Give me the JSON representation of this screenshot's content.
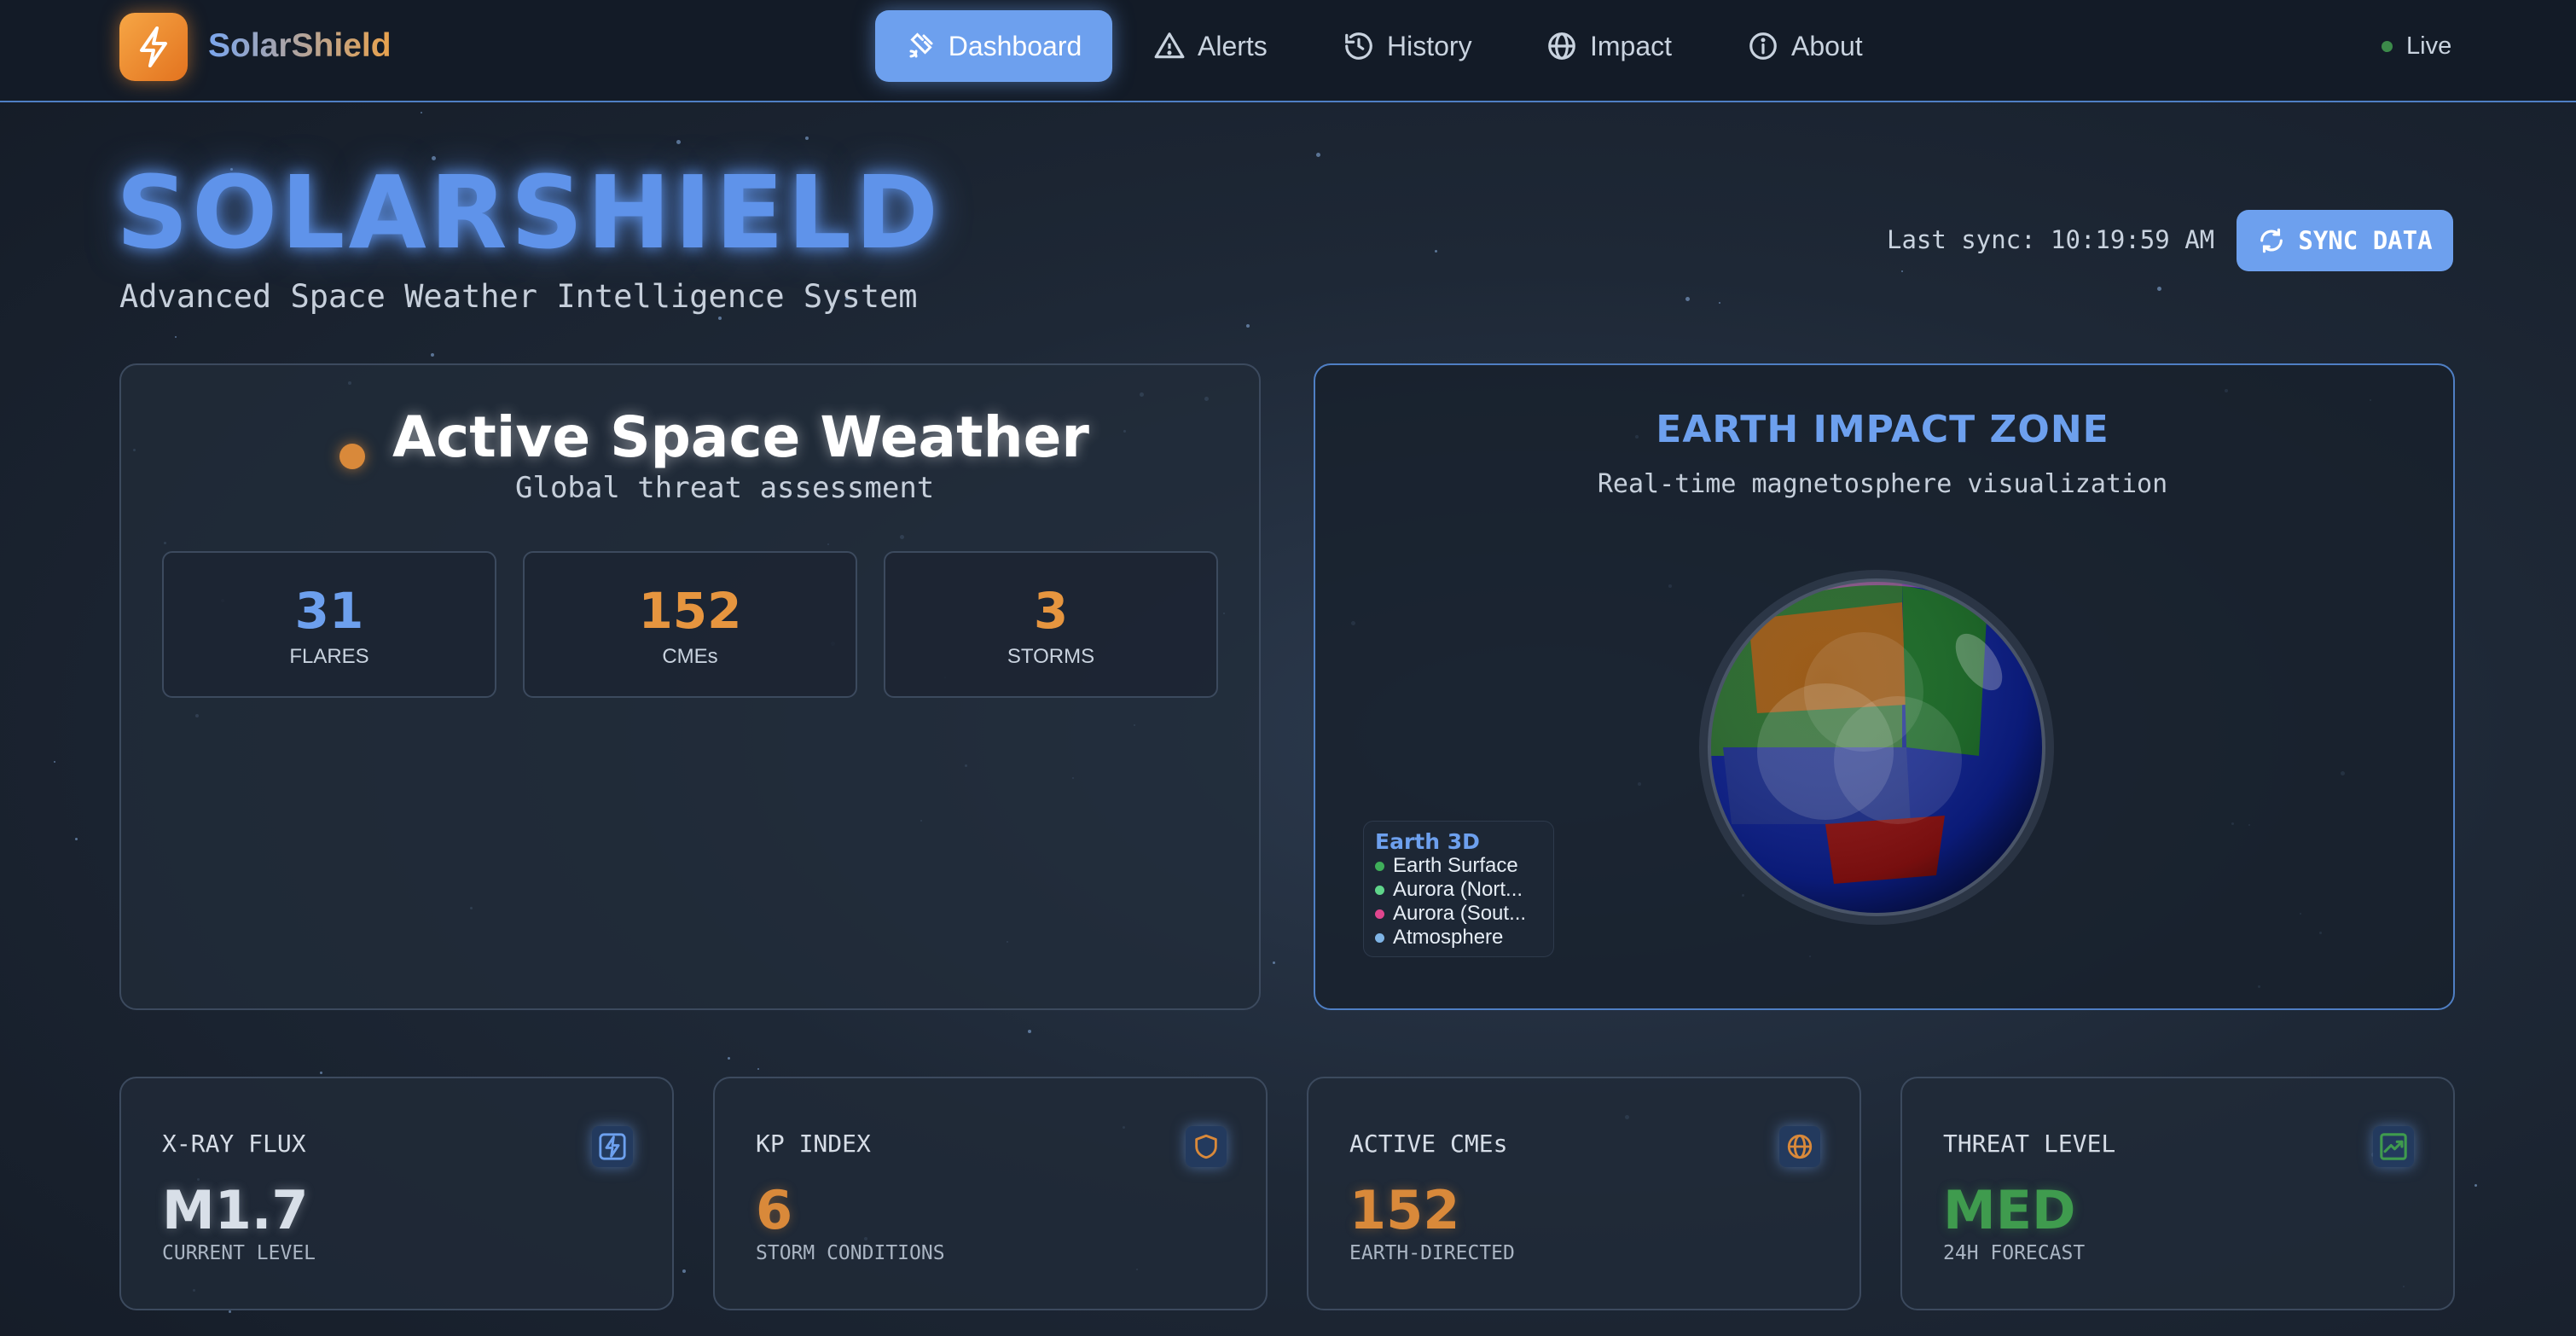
{
  "app": {
    "name": "SolarShield",
    "live_label": "Live"
  },
  "nav": {
    "items": [
      {
        "label": "Dashboard",
        "icon": "satellite-icon",
        "active": true
      },
      {
        "label": "Alerts",
        "icon": "alert-triangle-icon"
      },
      {
        "label": "History",
        "icon": "history-icon"
      },
      {
        "label": "Impact",
        "icon": "globe-icon"
      },
      {
        "label": "About",
        "icon": "info-icon"
      }
    ]
  },
  "hero": {
    "title": "SOLARSHIELD",
    "subtitle": "Advanced Space Weather Intelligence System",
    "sync_label": "Last sync: 10:19:59 AM",
    "sync_button": "SYNC DATA"
  },
  "active_weather": {
    "title": "Active Space Weather",
    "subtitle": "Global threat assessment",
    "stats": [
      {
        "value": "31",
        "label": "FLARES",
        "color": "#6da0ee"
      },
      {
        "value": "152",
        "label": "CMEs",
        "color": "#e6953f"
      },
      {
        "value": "3",
        "label": "STORMS",
        "color": "#e6953f"
      }
    ]
  },
  "earth_impact": {
    "title": "EARTH IMPACT ZONE",
    "subtitle": "Real-time magnetosphere visualization",
    "legend": {
      "title": "Earth 3D",
      "items": [
        {
          "label": "Earth Surface",
          "color": "#3fae5a"
        },
        {
          "label": "Aurora (Nort...",
          "color": "#5fd58a"
        },
        {
          "label": "Aurora (Sout...",
          "color": "#e0468e"
        },
        {
          "label": "Atmosphere",
          "color": "#7fb4e6"
        }
      ]
    }
  },
  "metrics": [
    {
      "title": "X-RAY FLUX",
      "value": "M1.7",
      "sub": "CURRENT LEVEL",
      "icon": "lightning-icon",
      "color": "#d8dfe8"
    },
    {
      "title": "KP INDEX",
      "value": "6",
      "sub": "STORM CONDITIONS",
      "icon": "shield-icon",
      "color": "#d9893a"
    },
    {
      "title": "ACTIVE CMEs",
      "value": "152",
      "sub": "EARTH-DIRECTED",
      "icon": "globe-icon",
      "color": "#d9893a"
    },
    {
      "title": "THREAT LEVEL",
      "value": "MED",
      "sub": "24H FORECAST",
      "icon": "trending-up-icon",
      "color": "#3f9b4e"
    }
  ],
  "colors": {
    "accent": "#6da0ee",
    "warning": "#d9893a",
    "success": "#3f9b4e"
  }
}
